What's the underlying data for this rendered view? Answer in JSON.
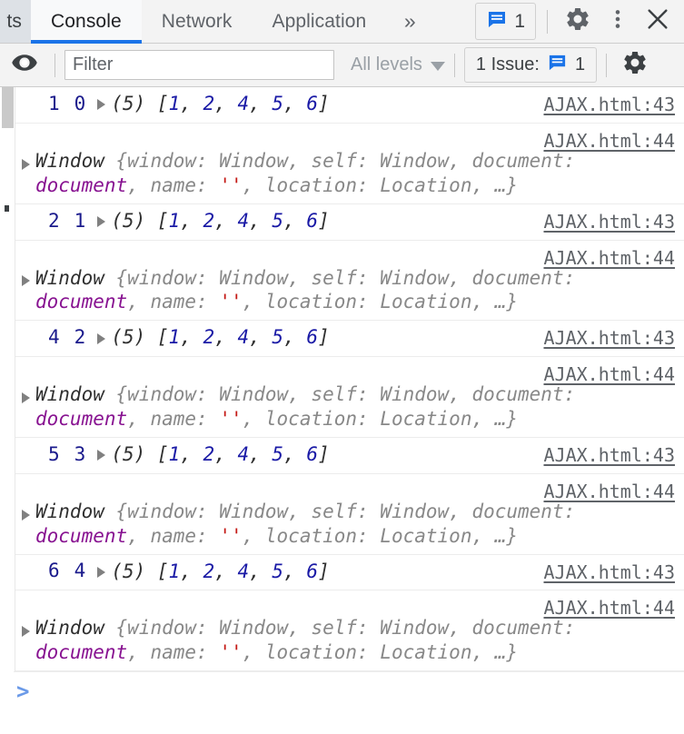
{
  "tabbar": {
    "partial_tab": "ts",
    "tabs": [
      {
        "label": "Console",
        "active": true
      },
      {
        "label": "Network",
        "active": false
      },
      {
        "label": "Application",
        "active": false
      }
    ],
    "overflow_label": "»",
    "issues_count": "1",
    "icons": {
      "message": "message-issue-icon",
      "settings": "gear-icon",
      "more": "kebab-menu-icon",
      "close": "close-icon"
    }
  },
  "filterbar": {
    "eye_icon": "eye-icon",
    "filter_placeholder": "Filter",
    "filter_value": "",
    "levels_label": "All levels",
    "issues_label": "1 Issue:",
    "issues_count": "1",
    "settings_icon": "gear-icon"
  },
  "console": {
    "entries": [
      {
        "type": "array",
        "counter_a": "1",
        "counter_b": "0",
        "length": "(5)",
        "open": "[",
        "values": [
          "1",
          "2",
          "4",
          "5",
          "6"
        ],
        "close": "]",
        "source": "AJAX.html:43"
      },
      {
        "type": "object",
        "class_name": "Window",
        "body": "{window: Window, self: Window, document: document, name: '', location: Location, …}",
        "source": "AJAX.html:44"
      },
      {
        "type": "array",
        "counter_a": "2",
        "counter_b": "1",
        "length": "(5)",
        "open": "[",
        "values": [
          "1",
          "2",
          "4",
          "5",
          "6"
        ],
        "close": "]",
        "source": "AJAX.html:43"
      },
      {
        "type": "object",
        "class_name": "Window",
        "body": "{window: Window, self: Window, document: document, name: '', location: Location, …}",
        "source": "AJAX.html:44"
      },
      {
        "type": "array",
        "counter_a": "4",
        "counter_b": "2",
        "length": "(5)",
        "open": "[",
        "values": [
          "1",
          "2",
          "4",
          "5",
          "6"
        ],
        "close": "]",
        "source": "AJAX.html:43"
      },
      {
        "type": "object",
        "class_name": "Window",
        "body": "{window: Window, self: Window, document: document, name: '', location: Location, …}",
        "source": "AJAX.html:44"
      },
      {
        "type": "array",
        "counter_a": "5",
        "counter_b": "3",
        "length": "(5)",
        "open": "[",
        "values": [
          "1",
          "2",
          "4",
          "5",
          "6"
        ],
        "close": "]",
        "source": "AJAX.html:43"
      },
      {
        "type": "object",
        "class_name": "Window",
        "body": "{window: Window, self: Window, document: document, name: '', location: Location, …}",
        "source": "AJAX.html:44"
      },
      {
        "type": "array",
        "counter_a": "6",
        "counter_b": "4",
        "length": "(5)",
        "open": "[",
        "values": [
          "1",
          "2",
          "4",
          "5",
          "6"
        ],
        "close": "]",
        "source": "AJAX.html:43"
      },
      {
        "type": "object",
        "class_name": "Window",
        "body": "{window: Window, self: Window, document: document, name: '', location: Location, …}",
        "source": "AJAX.html:44"
      }
    ],
    "prompt_glyph": ">",
    "prompt_value": ""
  },
  "colors": {
    "accent": "#1a73e8",
    "number": "#1a1aa6",
    "counter": "#1a1a8c",
    "object_value": "#881391",
    "string_value": "#c41a16",
    "property": "#888888",
    "link": "#5f6368",
    "prompt": "#6b9ae8"
  }
}
